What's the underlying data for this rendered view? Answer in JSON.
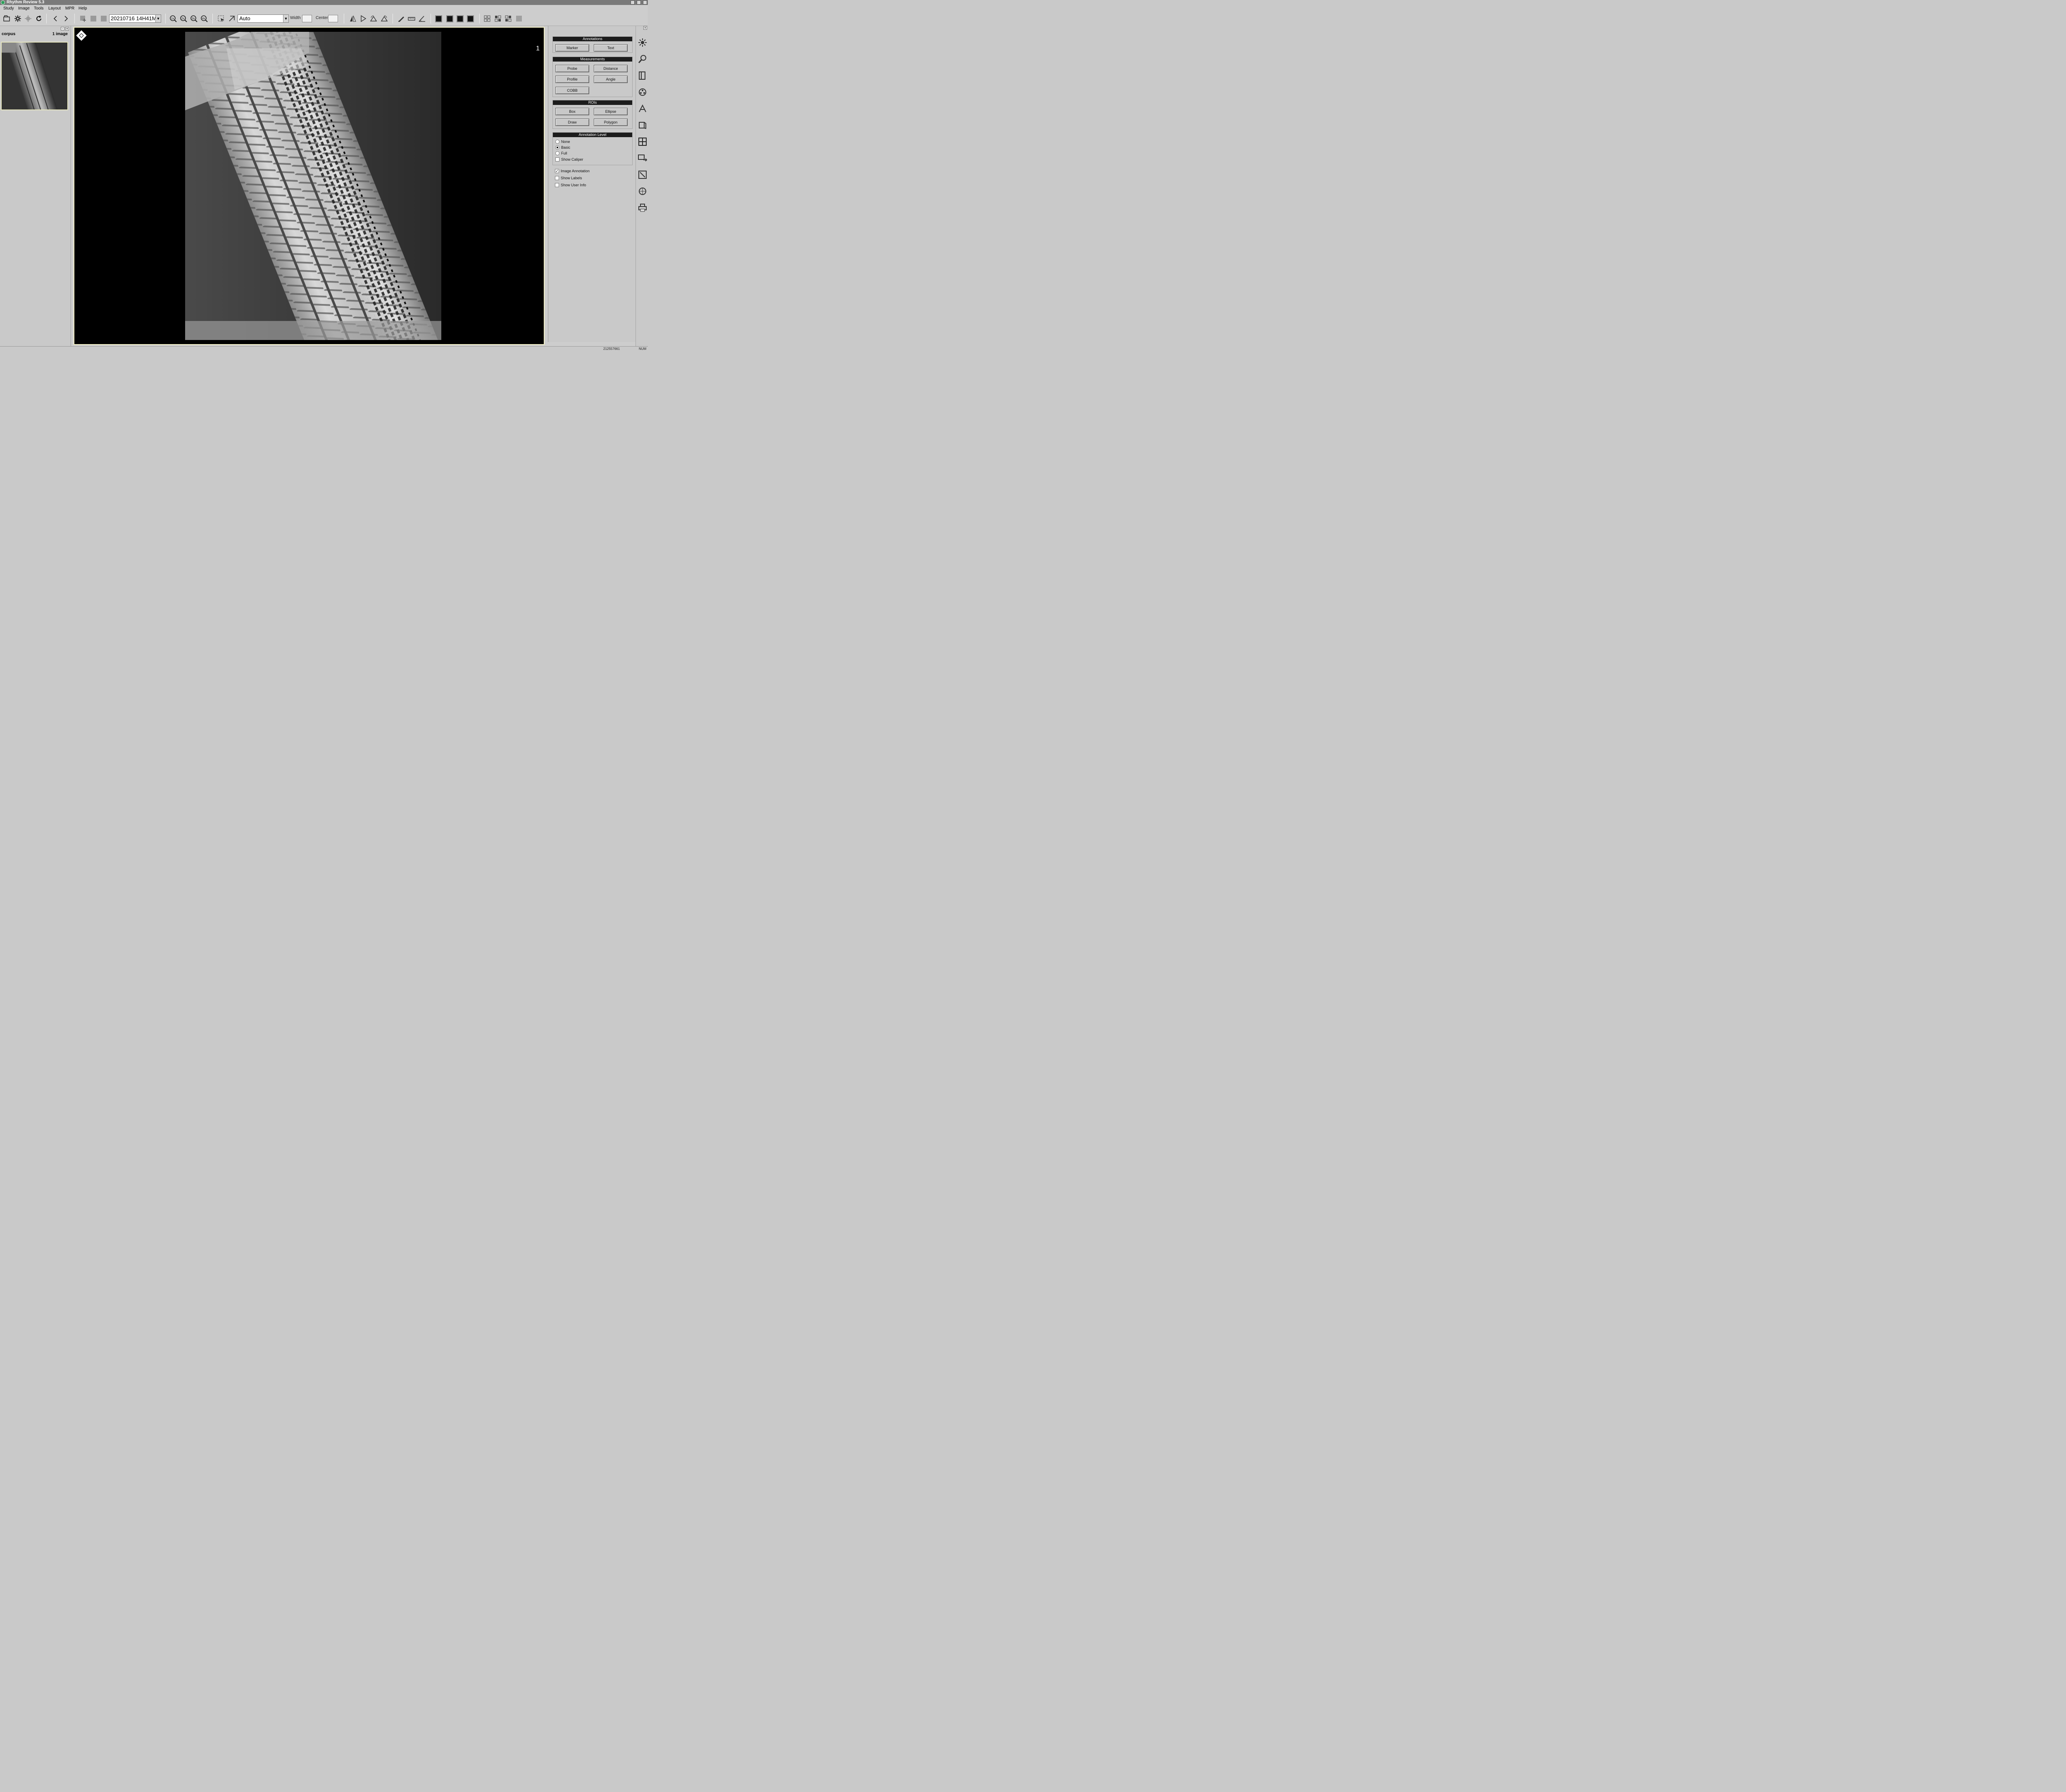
{
  "window": {
    "title": "Rhythm Review 5.3"
  },
  "menu": [
    "Study",
    "Image",
    "Tools",
    "Layout",
    "MPR",
    "Help"
  ],
  "toolbar": {
    "series_select": "20210716 14H41M",
    "window_preset": "Auto",
    "width_label": "Width",
    "center_label": "Center",
    "width_value": "",
    "center_value": "",
    "zoom_labels": [
      "1x",
      "2x",
      "3x",
      "4x"
    ],
    "icons": [
      "open-study-icon",
      "settings-gear-icon",
      "gear-disabled-icon",
      "reset-icon",
      "previous-icon",
      "next-icon",
      "add-series-icon",
      "blank-a-icon",
      "blank-b-icon",
      "zoom-1x-icon",
      "zoom-2x-icon",
      "zoom-3x-icon",
      "zoom-4x-icon",
      "select-tool-icon",
      "pan-tool-icon",
      "flip-horizontal-icon",
      "play-icon",
      "rotate-left-icon",
      "rotate-right-icon",
      "pen-icon",
      "ruler-icon",
      "angle-icon",
      "layout-1-icon",
      "layout-2-icon",
      "layout-3-icon",
      "layout-4-icon",
      "grid-a-icon",
      "grid-b-icon",
      "grid-c-icon",
      "grid-d-icon"
    ]
  },
  "left_panel": {
    "study_name": "corpus",
    "image_count": "1 image"
  },
  "viewer": {
    "image_number": "1"
  },
  "right_panel": {
    "annotations": {
      "title": "Annotations",
      "buttons": [
        "Marker",
        "Text"
      ]
    },
    "measurements": {
      "title": "Measurements",
      "buttons": [
        "Probe",
        "Distance",
        "Profile",
        "Angle",
        "COBB"
      ]
    },
    "rois": {
      "title": "ROIs",
      "buttons": [
        "Box",
        "Ellipse",
        "Draw",
        "Polygon"
      ]
    },
    "annotation_level": {
      "title": "Annotation Level",
      "options": [
        "None",
        "Basic",
        "Full"
      ],
      "selected": "Basic",
      "show_caliper": "Show Caliper"
    },
    "checkboxes": [
      {
        "label": "Image Annotation",
        "checked": true
      },
      {
        "label": "Show Labels",
        "checked": false
      },
      {
        "label": "Show User Info",
        "checked": false
      }
    ]
  },
  "right_strip_icons": [
    "brightness-icon",
    "magnifier-icon",
    "book-icon",
    "film-reel-icon",
    "text-annotation-icon",
    "3d-cube-icon",
    "grid-layout-icon",
    "monitor-transfer-icon",
    "export-icon",
    "volume-cube-icon",
    "printer-icon"
  ],
  "status": {
    "left": "",
    "right_number": "212557661",
    "num": "NUM"
  }
}
